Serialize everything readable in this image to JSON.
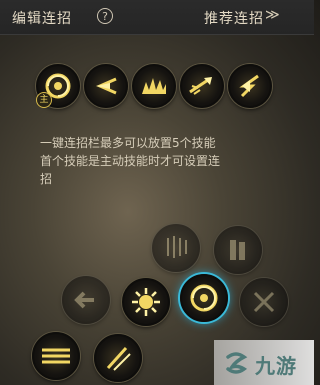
{
  "header": {
    "title": "编辑连招",
    "help_icon": "?",
    "recommend_label": "推荐连招",
    "chevrons": "≫"
  },
  "slots": [
    {
      "icon": "swirl-skill-icon",
      "tag": "主"
    },
    {
      "icon": "dash-skill-icon"
    },
    {
      "icon": "flame-wave-skill-icon"
    },
    {
      "icon": "fire-arrow-skill-icon"
    },
    {
      "icon": "lightning-arrow-skill-icon"
    }
  ],
  "description": {
    "line1": "一键连招栏最多可以放置5个技能",
    "line2": "首个技能是主动技能时才可设置连",
    "line3": "招"
  },
  "watermark": {
    "text": "九游"
  },
  "colors": {
    "accent": "#f2d763",
    "selected_ring": "#3ab9d8"
  }
}
